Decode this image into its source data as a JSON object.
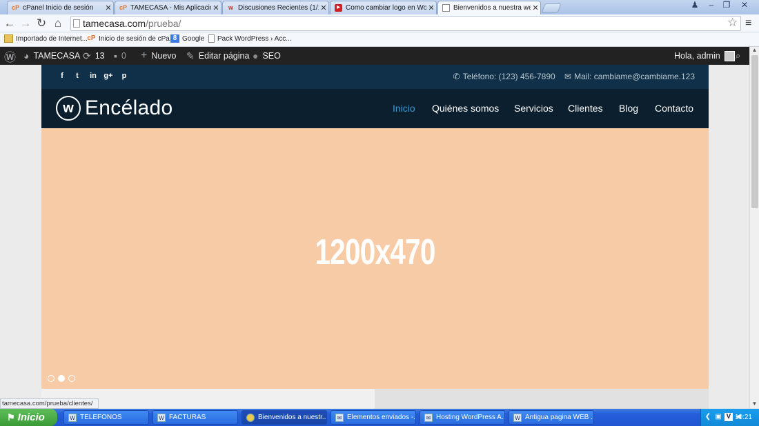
{
  "browser": {
    "tabs": [
      {
        "label": "cPanel Inicio de sesión",
        "icon": "cpanel-icon"
      },
      {
        "label": "TAMECASA - Mis Aplicacione",
        "icon": "cpanel-icon"
      },
      {
        "label": "Discusiones Recientes (1/1)",
        "icon": "wordpress-forum-icon"
      },
      {
        "label": "Como cambiar logo en Wordi",
        "icon": "youtube-icon"
      },
      {
        "label": "Bienvenidos a nuestra web -",
        "icon": "page-icon"
      }
    ],
    "url_host": "tamecasa.com",
    "url_path": "/prueba/",
    "bookmarks": [
      {
        "label": "Importado de Internet...",
        "icon": "folder-icon"
      },
      {
        "label": "Inicio de sesión de cPa...",
        "icon": "cpanel-icon"
      },
      {
        "label": "Google",
        "icon": "google-icon"
      },
      {
        "label": "Pack WordPress › Acc...",
        "icon": "page-icon"
      }
    ],
    "status_url": "tamecasa.com/prueba/clientes/"
  },
  "adminbar": {
    "site_name": "TAMECASA",
    "updates_count": "13",
    "comments_count": "0",
    "new_label": "Nuevo",
    "edit_label": "Editar página",
    "seo_label": "SEO",
    "greeting": "Hola, admin"
  },
  "site": {
    "phone": "Teléfono: (123) 456-7890",
    "mail": "Mail: cambiame@cambiame.123",
    "logo_text": "Encélado",
    "logo_mark": "w",
    "nav": [
      "Inicio",
      "Quiénes somos",
      "Servicios",
      "Clientes",
      "Blog",
      "Contacto"
    ],
    "hero_label": "1200x470",
    "social": [
      "f",
      "t",
      "in",
      "g+",
      "p"
    ],
    "hero_bg": "#f7cba6",
    "nav_active_color": "#3b9bd4"
  },
  "taskbar": {
    "start_label": "Inicio",
    "tasks": [
      "TELEFONOS",
      "FACTURAS",
      "Bienvenidos a nuestr...",
      "Elementos enviados -...",
      "Hosting WordPress A...",
      "Antigua pagina WEB ..."
    ],
    "clock": "10:21"
  }
}
